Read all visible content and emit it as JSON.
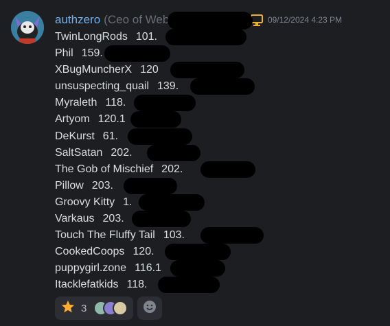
{
  "message": {
    "username": "authzero",
    "nickname": "(Ceo of Webfish Airlines)",
    "timestamp": "09/12/2024 4:23 PM",
    "badge_icons": [
      "fishing-rod-icon",
      "monitor-icon"
    ],
    "lines": [
      {
        "name": "TwinLongRods",
        "score": "101."
      },
      {
        "name": "Phil",
        "score": "159."
      },
      {
        "name": "XBugMuncherX",
        "score": "120"
      },
      {
        "name": "unsuspecting_quail",
        "score": "139."
      },
      {
        "name": "Myraleth",
        "score": "118."
      },
      {
        "name": "Artyom",
        "score": "120.1"
      },
      {
        "name": "DeKurst",
        "score": "61."
      },
      {
        "name": "SaltSatan",
        "score": "202."
      },
      {
        "name": "The Gob of Mischief",
        "score": "202."
      },
      {
        "name": "Pillow",
        "score": "203."
      },
      {
        "name": "Groovy Kitty",
        "score": "1."
      },
      {
        "name": "Varkaus",
        "score": "203."
      },
      {
        "name": "Touch The Fluffy Tail",
        "score": "103."
      },
      {
        "name": "CookedCoops",
        "score": "120."
      },
      {
        "name": "puppygirl.zone",
        "score": "116.1"
      },
      {
        "name": "Itacklefatkids",
        "score": "118."
      }
    ]
  },
  "reaction": {
    "emoji": "star-icon",
    "count": "3"
  },
  "colors": {
    "username": "#6fb0ee",
    "background": "#1d1e22"
  }
}
